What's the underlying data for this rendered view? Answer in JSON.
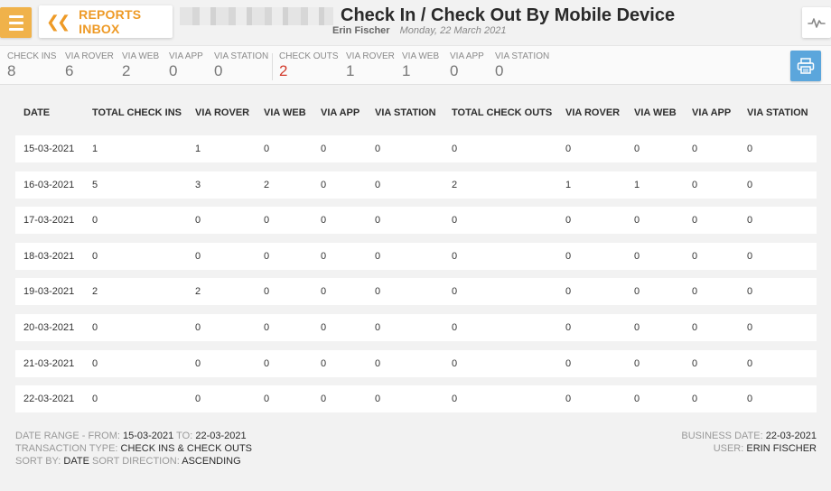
{
  "header": {
    "inbox_label": "REPORTS INBOX",
    "title": "Check In / Check Out By Mobile Device",
    "user_name": "Erin Fischer",
    "date": "Monday, 22 March 2021"
  },
  "summary": {
    "check_ins": [
      {
        "label": "CHECK INS",
        "value": "8"
      },
      {
        "label": "VIA ROVER",
        "value": "6"
      },
      {
        "label": "VIA WEB",
        "value": "2"
      },
      {
        "label": "VIA APP",
        "value": "0"
      },
      {
        "label": "VIA STATION",
        "value": "0"
      }
    ],
    "check_outs": [
      {
        "label": "CHECK OUTS",
        "value": "2"
      },
      {
        "label": "VIA ROVER",
        "value": "1"
      },
      {
        "label": "VIA WEB",
        "value": "1"
      },
      {
        "label": "VIA APP",
        "value": "0"
      },
      {
        "label": "VIA STATION",
        "value": "0"
      }
    ],
    "accent_color": "#d23a2b"
  },
  "table": {
    "columns": [
      "DATE",
      "TOTAL CHECK INS",
      "VIA ROVER",
      "VIA WEB",
      "VIA APP",
      "VIA STATION",
      "TOTAL CHECK OUTS",
      "VIA ROVER",
      "VIA WEB",
      "VIA APP",
      "VIA STATION"
    ],
    "rows": [
      [
        "15-03-2021",
        "1",
        "1",
        "0",
        "0",
        "0",
        "0",
        "0",
        "0",
        "0",
        "0"
      ],
      [
        "16-03-2021",
        "5",
        "3",
        "2",
        "0",
        "0",
        "2",
        "1",
        "1",
        "0",
        "0"
      ],
      [
        "17-03-2021",
        "0",
        "0",
        "0",
        "0",
        "0",
        "0",
        "0",
        "0",
        "0",
        "0"
      ],
      [
        "18-03-2021",
        "0",
        "0",
        "0",
        "0",
        "0",
        "0",
        "0",
        "0",
        "0",
        "0"
      ],
      [
        "19-03-2021",
        "2",
        "2",
        "0",
        "0",
        "0",
        "0",
        "0",
        "0",
        "0",
        "0"
      ],
      [
        "20-03-2021",
        "0",
        "0",
        "0",
        "0",
        "0",
        "0",
        "0",
        "0",
        "0",
        "0"
      ],
      [
        "21-03-2021",
        "0",
        "0",
        "0",
        "0",
        "0",
        "0",
        "0",
        "0",
        "0",
        "0"
      ],
      [
        "22-03-2021",
        "0",
        "0",
        "0",
        "0",
        "0",
        "0",
        "0",
        "0",
        "0",
        "0"
      ]
    ]
  },
  "footer": {
    "date_range_label": "DATE RANGE - FROM:",
    "date_from": "15-03-2021",
    "to_label": "TO:",
    "date_to": "22-03-2021",
    "transaction_type_label": "TRANSACTION TYPE:",
    "transaction_type": "CHECK INS & CHECK OUTS",
    "sort_by_label": "SORT BY:",
    "sort_by": "DATE",
    "sort_direction_label": "SORT DIRECTION:",
    "sort_direction": "ASCENDING",
    "business_date_label": "BUSINESS DATE:",
    "business_date": "22-03-2021",
    "user_label": "USER:",
    "user": "ERIN FISCHER"
  },
  "icons": {
    "menu": "hamburger-icon",
    "back": "double-chevron-left-icon",
    "activity": "pulse-line-icon",
    "print": "printer-icon"
  }
}
